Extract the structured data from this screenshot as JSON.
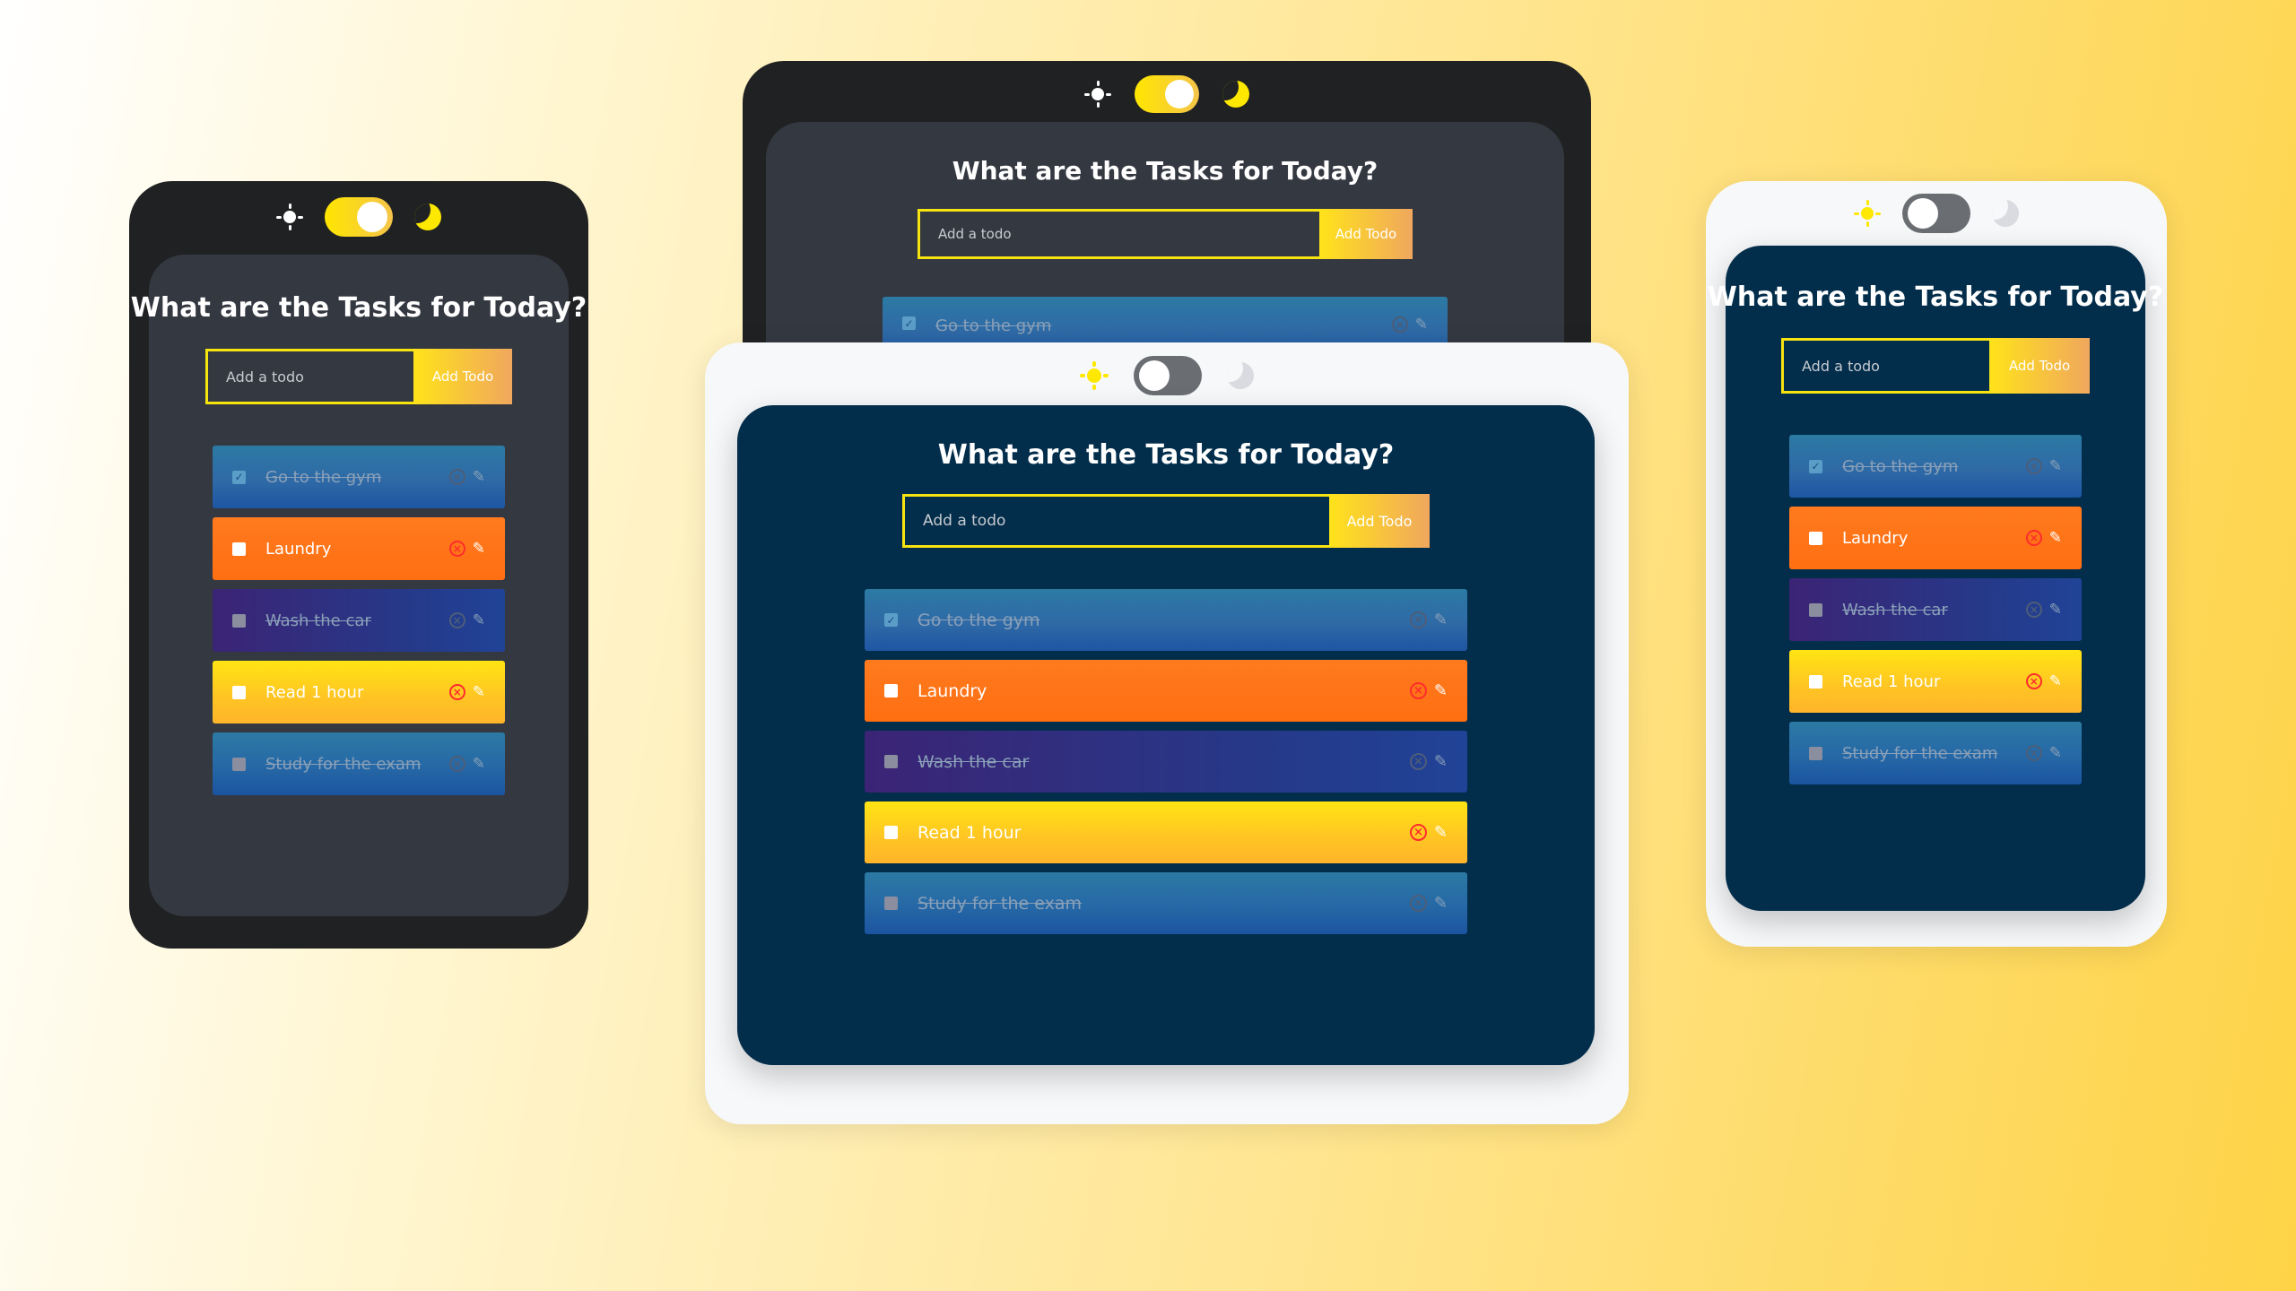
{
  "app": {
    "title": "What are the Tasks for Today?",
    "input_placeholder": "Add a todo",
    "add_button": "Add Todo"
  },
  "todos": [
    {
      "label": "Go to the gym",
      "completed": true
    },
    {
      "label": "Laundry",
      "completed": false
    },
    {
      "label": "Wash the car",
      "completed": true
    },
    {
      "label": "Read 1 hour",
      "completed": false
    },
    {
      "label": "Study for the exam",
      "completed": true
    }
  ],
  "mockups": [
    {
      "name": "phone-left",
      "theme": "dark",
      "toggle_on": true
    },
    {
      "name": "tablet-back",
      "theme": "dark",
      "toggle_on": true
    },
    {
      "name": "tablet-front",
      "theme": "light",
      "toggle_on": false
    },
    {
      "name": "phone-right",
      "theme": "light",
      "toggle_on": false
    }
  ],
  "icons": {
    "sun": "sun-icon",
    "moon": "moon-icon",
    "delete": "delete-icon",
    "edit": "edit-icon",
    "check": "checkmark-icon"
  },
  "colors": {
    "accent_yellow": "#f7e30f",
    "orange_task": "#ff7a1e",
    "navy_card": "#022d4b",
    "dark_card": "#343841",
    "dark_frame": "#202122",
    "light_frame": "#f7f8fa"
  }
}
